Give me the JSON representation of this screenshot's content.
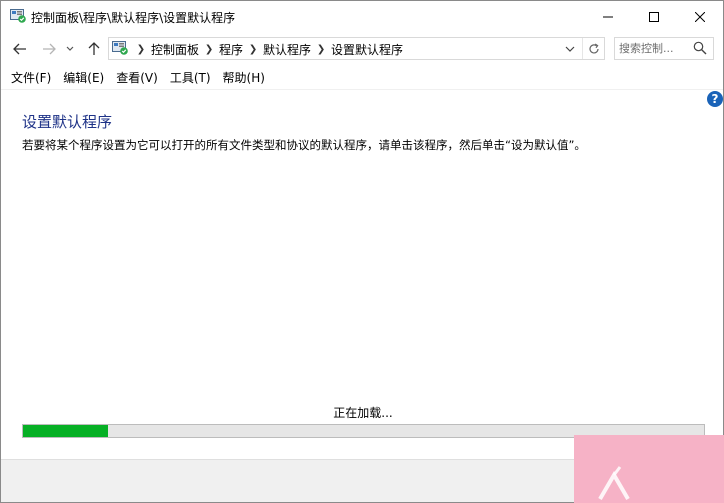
{
  "window": {
    "title": "控制面板\\程序\\默认程序\\设置默认程序"
  },
  "address": {
    "crumbs": [
      "控制面板",
      "程序",
      "默认程序",
      "设置默认程序"
    ]
  },
  "search": {
    "placeholder": "搜索控制..."
  },
  "menu": {
    "items": [
      "文件(F)",
      "编辑(E)",
      "查看(V)",
      "工具(T)",
      "帮助(H)"
    ]
  },
  "help": {
    "label": "?"
  },
  "content": {
    "title": "设置默认程序",
    "description": "若要将某个程序设置为它可以打开的所有文件类型和协议的默认程序，请单击该程序，然后单击“设为默认值”。",
    "loading_text": "正在加载...",
    "progress_fraction": 0.125
  },
  "colors": {
    "title_blue": "#1e3287",
    "progress_green": "#06b025",
    "help_blue": "#1a63b8",
    "watermark_pink": "#f6b2c6"
  },
  "icons": {
    "app": "control-panel-icon",
    "back": "arrow-left-icon",
    "forward": "arrow-right-icon",
    "recent": "chevron-down-icon",
    "up": "arrow-up-icon",
    "dropdown": "chevron-down-icon",
    "refresh": "refresh-icon",
    "search": "search-icon",
    "minimize": "minimize-icon",
    "maximize": "maximize-icon",
    "close": "close-icon"
  }
}
